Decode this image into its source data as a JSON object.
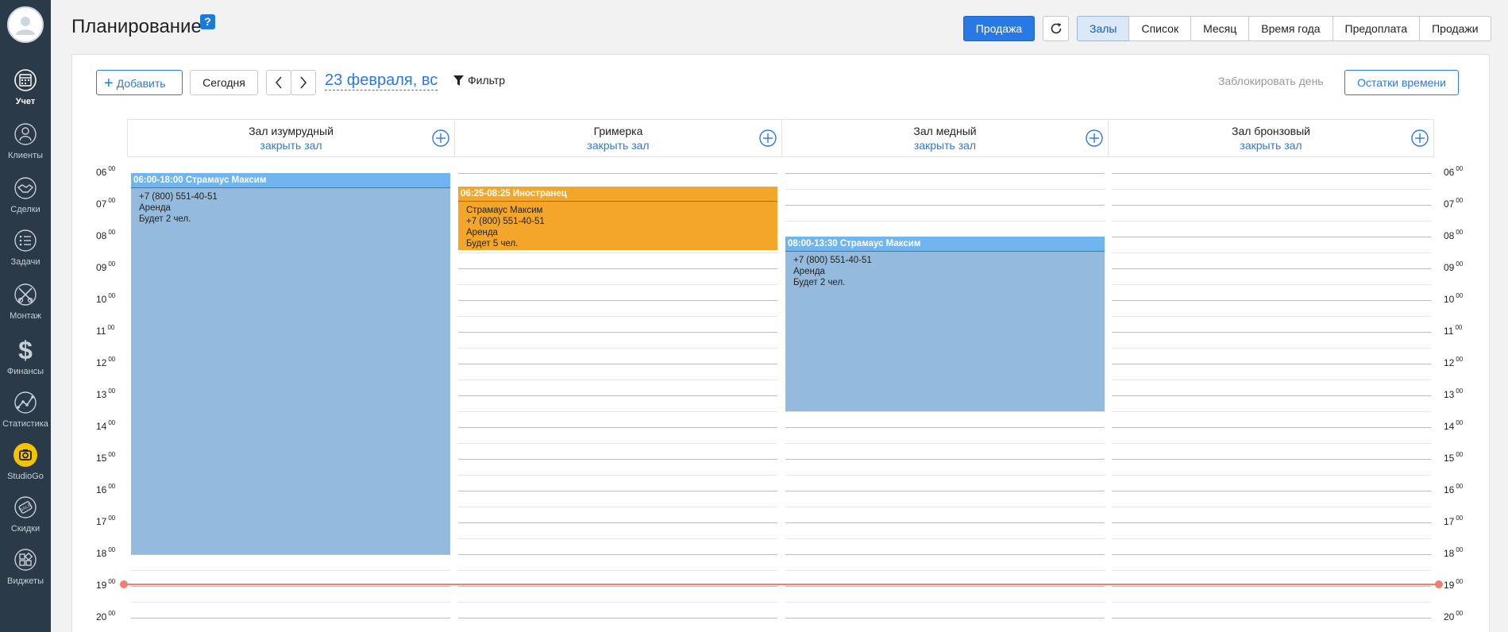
{
  "sidebar": {
    "items": [
      {
        "label": "Учет",
        "icon": "calendar-icon",
        "active": true
      },
      {
        "label": "Клиенты",
        "icon": "clients-icon"
      },
      {
        "label": "Сделки",
        "icon": "handshake-icon"
      },
      {
        "label": "Задачи",
        "icon": "tasks-icon"
      },
      {
        "label": "Монтаж",
        "icon": "montage-icon"
      },
      {
        "label": "Финансы",
        "icon": "dollar-icon"
      },
      {
        "label": "Статистика",
        "icon": "stats-icon"
      },
      {
        "label": "StudioGo",
        "icon": "studiogo-icon"
      },
      {
        "label": "Скидки",
        "icon": "discount-icon"
      },
      {
        "label": "Виджеты",
        "icon": "widgets-icon"
      }
    ]
  },
  "header": {
    "title": "Планирование",
    "help": "?",
    "sale_label": "Продажа",
    "tabs": [
      {
        "label": "Залы",
        "active": true
      },
      {
        "label": "Список"
      },
      {
        "label": "Месяц"
      },
      {
        "label": "Время года"
      },
      {
        "label": "Предоплата"
      },
      {
        "label": "Продажи"
      }
    ]
  },
  "toolbar": {
    "add_label": "Добавить",
    "today_label": "Сегодня",
    "date": "23 февраля, вс",
    "filter_label": "Фильтр",
    "lock_day_label": "Заблокировать день",
    "remains_label": "Остатки времени"
  },
  "rooms": [
    {
      "name": "Зал изумрудный",
      "close_label": "закрыть зал"
    },
    {
      "name": "Гримерка",
      "close_label": "закрыть зал"
    },
    {
      "name": "Зал медный",
      "close_label": "закрыть зал"
    },
    {
      "name": "Зал бронзовый",
      "close_label": "закрыть зал"
    }
  ],
  "hours": [
    "06",
    "07",
    "08",
    "09",
    "10",
    "11",
    "12",
    "13",
    "14",
    "15",
    "16",
    "17",
    "18",
    "19",
    "20"
  ],
  "minutes_sup": "00",
  "events": [
    {
      "room": 0,
      "title": "06:00-18:00  Страмаус Максим",
      "lines": [
        "+7 (800) 551-40-51",
        "Аренда",
        "Будет 2 чел."
      ],
      "color": "blue"
    },
    {
      "room": 1,
      "title": "06:25-08:25  Иностранец",
      "lines": [
        "Страмаус Максим",
        "+7 (800) 551-40-51",
        "Аренда",
        "Будет 5 чел."
      ],
      "color": "orange"
    },
    {
      "room": 2,
      "title": "08:00-13:30  Страмаус Максим",
      "lines": [
        "+7 (800) 551-40-51",
        "Аренда",
        "Будет 2 чел."
      ],
      "color": "blue"
    }
  ],
  "colors": {
    "accent": "#2979e5",
    "sidebar": "#2a3a48",
    "event_blue": "#94bbde",
    "event_blue_head": "#6fb6f1",
    "event_orange": "#f4a62a",
    "now_line": "#f08070"
  }
}
